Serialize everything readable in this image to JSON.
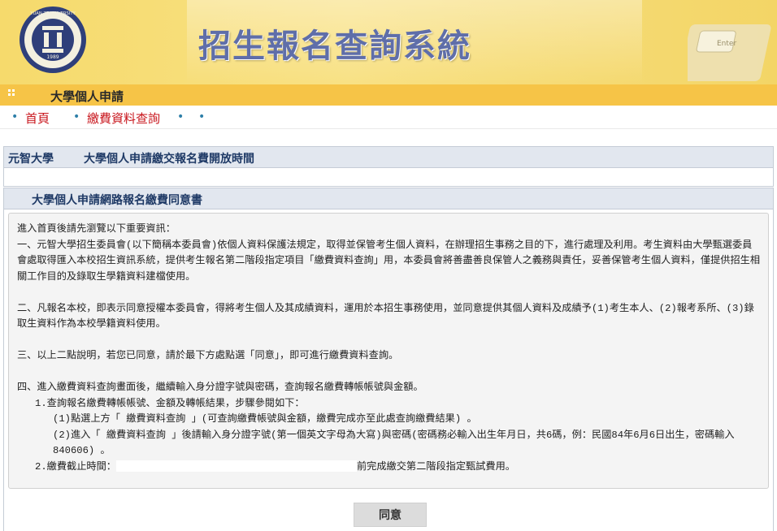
{
  "header": {
    "site_title": "招生報名查詢系統",
    "logo_year": "1989",
    "logo_text": "YUAN ZE UNIVERSITY",
    "deco_key_label": "Enter"
  },
  "subbar": {
    "title": "大學個人申請"
  },
  "nav": {
    "items": [
      {
        "label": "首頁"
      },
      {
        "label": "繳費資料查詢"
      }
    ]
  },
  "panel1": {
    "school": "元智大學",
    "heading": "大學個人申請繳交報名費開放時間"
  },
  "panel2": {
    "heading": "大學個人申請網路報名繳費同意書",
    "intro": "進入首頁後請先瀏覽以下重要資訊：",
    "p1": "一、元智大學招生委員會(以下簡稱本委員會)依個人資料保護法規定，取得並保管考生個人資料，在辦理招生事務之目的下，進行處理及利用。考生資料由大學甄選委員會處取得匯入本校招生資訊系統，提供考生報名第二階段指定項目「繳費資料查詢」用，本委員會將善盡善良保管人之義務與責任，妥善保管考生個人資料，僅提供招生相關工作目的及錄取生學籍資料建檔使用。",
    "p2": "二、凡報名本校，即表示同意授權本委員會，得將考生個人及其成績資料，運用於本招生事務使用，並同意提供其個人資料及成績予(1)考生本人、(2)報考系所、(3)錄取生資料作為本校學籍資料使用。",
    "p3": "三、以上二點說明，若您已同意，請於最下方處點選「同意」，即可進行繳費資料查詢。",
    "p4": "四、進入繳費資料查詢畫面後，繼續輸入身分證字號與密碼，查詢報名繳費轉帳帳號與金額。",
    "p4_1": "1.查詢報名繳費轉帳帳號、金額及轉帳結果，步驟參閱如下：",
    "p4_1a": "(1)點選上方「 繳費資料查詢 」(可查詢繳費帳號與金額，繳費完成亦至此處查詢繳費結果) 。",
    "p4_1b": "(2)進入「 繳費資料查詢 」後請輸入身分證字號(第一個英文字母為大寫)與密碼(密碼務必輸入出生年月日，共6碼，例：民國84年6月6日出生，密碼輸入840606) 。",
    "p4_2_prefix": "2.繳費截止時間：",
    "p4_2_suffix": "前完成繳交第二階段指定甄試費用。"
  },
  "buttons": {
    "agree": "同意"
  },
  "colors": {
    "banner": "#f6da6c",
    "subbar": "#f6c447",
    "nav_link": "#c8161d",
    "title": "#5f6ea9"
  }
}
